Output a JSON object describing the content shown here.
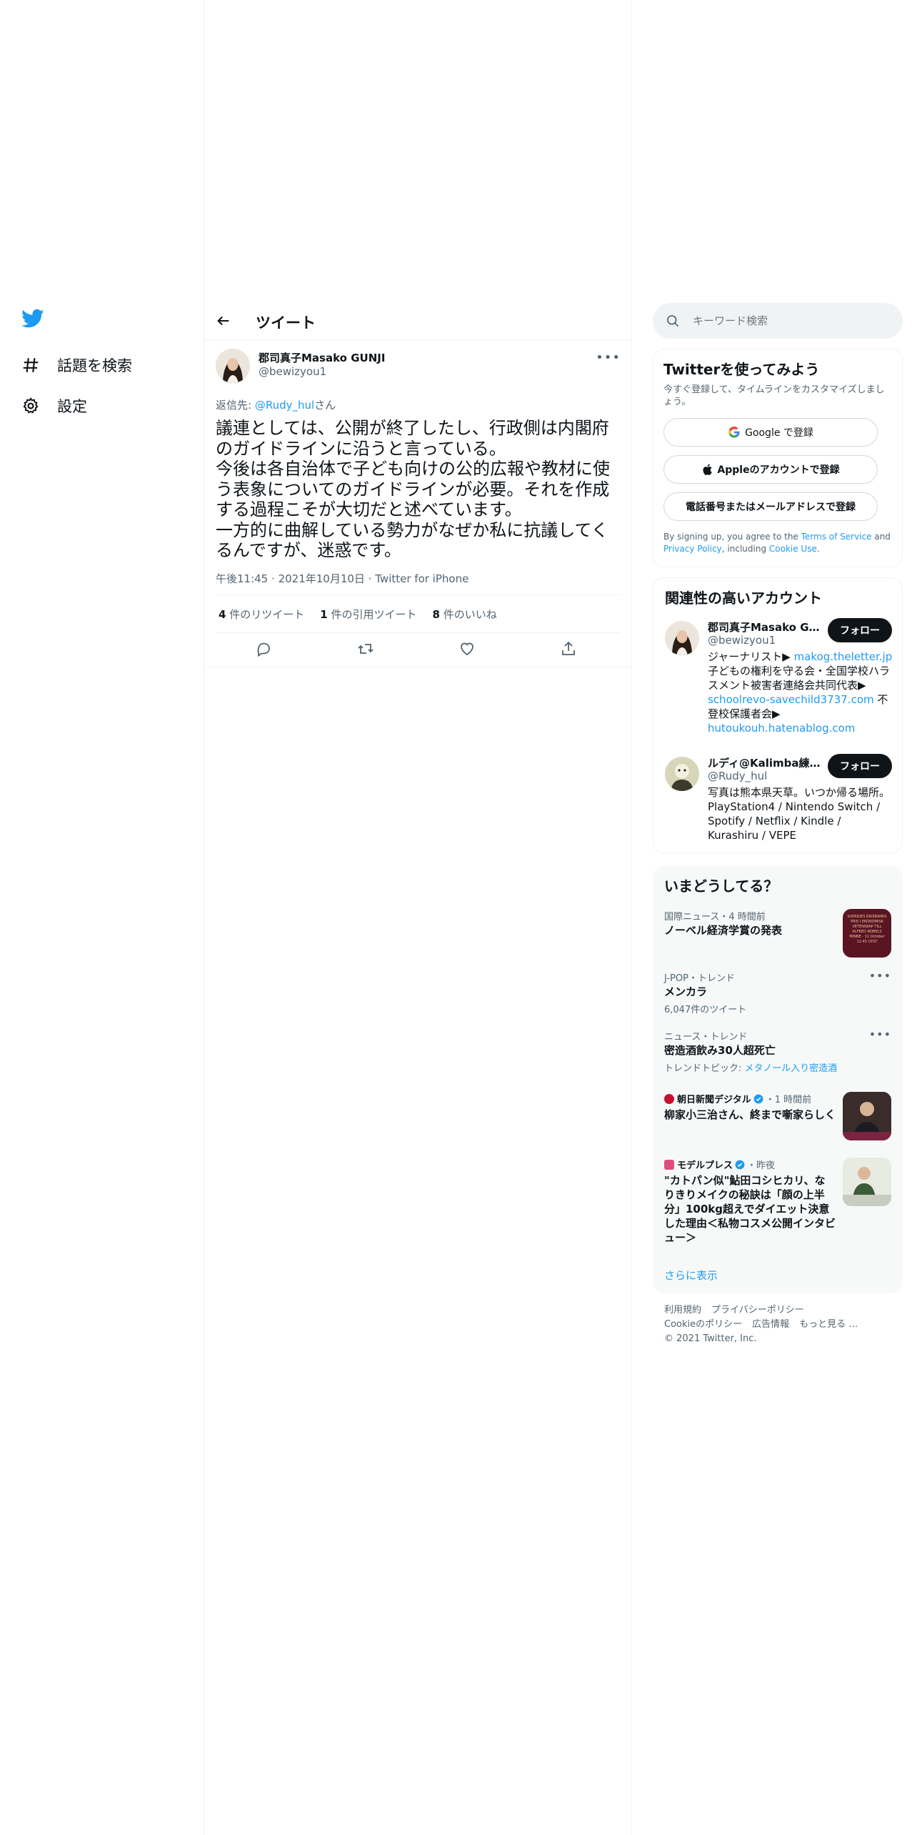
{
  "nav": {
    "items": [
      {
        "label": "話題を検索",
        "icon": "hashtag-icon"
      },
      {
        "label": "設定",
        "icon": "gear-icon"
      }
    ]
  },
  "header": {
    "title": "ツイート"
  },
  "tweet": {
    "author_name": "郡司真子Masako GUNJI",
    "author_handle": "@bewizyou1",
    "reply_prefix": "返信先: ",
    "reply_to": "@Rudy_hul",
    "reply_suffix": "さん",
    "text": "議連としては、公開が終了したし、行政側は内閣府のガイドラインに沿うと言っている。\n今後は各自治体で子ども向けの公的広報や教材に使う表象についてのガイドラインが必要。それを作成する過程こそが大切だと述べています。\n一方的に曲解している勢力がなぜか私に抗議してくるんですが、迷惑です。",
    "time": "午後11:45",
    "date": "2021年10月10日",
    "source": "Twitter for iPhone",
    "retweets_count": "4",
    "retweets_label": "件のリツイート",
    "quotes_count": "1",
    "quotes_label": "件の引用ツイート",
    "likes_count": "8",
    "likes_label": "件のいいね"
  },
  "search": {
    "placeholder": "キーワード検索"
  },
  "signup": {
    "title": "Twitterを使ってみよう",
    "subtitle": "今すぐ登録して、タイムラインをカスタマイズしましょう。",
    "google_label": "Google で登録",
    "apple_label": "Appleのアカウントで登録",
    "phone_label": "電話番号またはメールアドレスで登録",
    "legal_1": "By signing up, you agree to the ",
    "terms": "Terms of Service",
    "legal_2": " and ",
    "privacy": "Privacy Policy",
    "legal_3": ", including ",
    "cookie": "Cookie Use",
    "legal_4": "."
  },
  "related": {
    "title": "関連性の高いアカウント",
    "follow_label": "フォロー",
    "accounts": [
      {
        "name": "郡司真子Masako GUNJI",
        "handle": "@bewizyou1",
        "bio_1": "ジャーナリスト▶ ",
        "bio_link_1": "makog.theletter.jp",
        "bio_2": " 子どもの権利を守る会・全国学校ハラスメント被害者連絡会共同代表▶ ",
        "bio_link_2": "schoolrevo-savechild3737.com",
        "bio_3": " 不登校保護者会▶ ",
        "bio_link_3": "hutoukouh.hatenablog.com"
      },
      {
        "name": "ルディ@Kalimba練習中",
        "handle": "@Rudy_hul",
        "bio_1": "写真は熊本県天草。いつか帰る場所。PlayStation4 / Nintendo Switch / Spotify / Netflix / Kindle / Kurashiru / VEPE"
      }
    ]
  },
  "trends": {
    "title": "いまどうしてる？",
    "items": [
      {
        "meta": "国際ニュース・4 時間前",
        "name": "ノーベル経済学賞の発表",
        "thumb_text": "SVERIGES RIKSBANKS PRIS I EKONOMISK VETENSKAP TILL ALFRED NOBELS MINNE · 11 October 11:45 CEST"
      },
      {
        "meta": "J-POP・トレンド",
        "name": "メンカラ",
        "sub": "6,047件のツイート"
      },
      {
        "meta": "ニュース・トレンド",
        "name": "密造酒飲み30人超死亡",
        "sub_prefix": "トレンドトピック: ",
        "sub_link": "メタノール入り密造酒"
      },
      {
        "source": "朝日新聞デジタル",
        "time": "・1 時間前",
        "name": "柳家小三治さん、終まで噺家らしく"
      },
      {
        "source": "モデルプレス",
        "time": "・昨夜",
        "name": "\"カトパン似\"鮎田コシヒカリ、なりきりメイクの秘訣は「顔の上半分」100kg超えでダイエット決意した理由＜私物コスメ公開インタビュー＞"
      }
    ],
    "show_more": "さらに表示"
  },
  "footer": {
    "links_1": [
      "利用規約",
      "プライバシーポリシー"
    ],
    "links_2": [
      "Cookieのポリシー",
      "広告情報",
      "もっと見る …"
    ],
    "copyright": "© 2021 Twitter, Inc."
  },
  "colors": {
    "accent": "#1d9bf0",
    "text": "#0f1419",
    "muted": "#536471",
    "border": "#eff3f4"
  }
}
